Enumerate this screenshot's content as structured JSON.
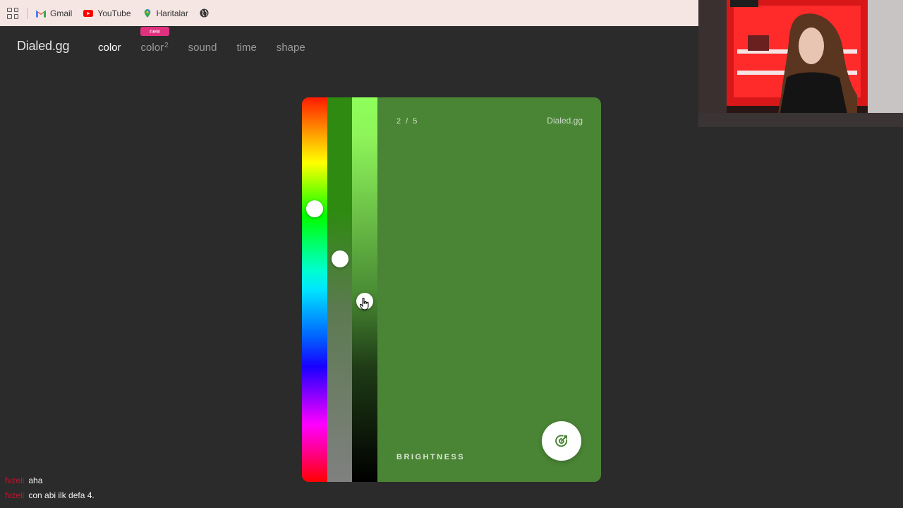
{
  "bookmarks": {
    "items": [
      {
        "label": "Gmail",
        "icon": "gmail-icon"
      },
      {
        "label": "YouTube",
        "icon": "youtube-icon"
      },
      {
        "label": "Haritalar",
        "icon": "maps-pin-icon"
      }
    ]
  },
  "site": {
    "logo": "Dialed.gg",
    "nav": [
      {
        "label": "color",
        "active": true
      },
      {
        "label": "color",
        "sup": "2",
        "badge": "new"
      },
      {
        "label": "sound"
      },
      {
        "label": "time"
      },
      {
        "label": "shape"
      }
    ]
  },
  "card": {
    "progress": "2 / 5",
    "brand": "Dialed.gg",
    "mode": "BRIGHTNESS",
    "background": "#4a8535",
    "submit_icon": "target-check-icon",
    "sliders": {
      "hue": {
        "value_fraction": 0.29
      },
      "saturation": {
        "value_fraction": 0.42
      },
      "brightness": {
        "value_fraction": 0.53
      }
    }
  },
  "chat": {
    "messages": [
      {
        "user": "fvzeli",
        "text": "aha"
      },
      {
        "user": "fvzeli",
        "text": "con abi ilk defa 4."
      }
    ]
  },
  "colors": {
    "page_bg": "#2b2b2b",
    "bookmark_bar": "#f5e6e3",
    "badge_new": "#e0317f",
    "chat_user": "#c01530"
  }
}
